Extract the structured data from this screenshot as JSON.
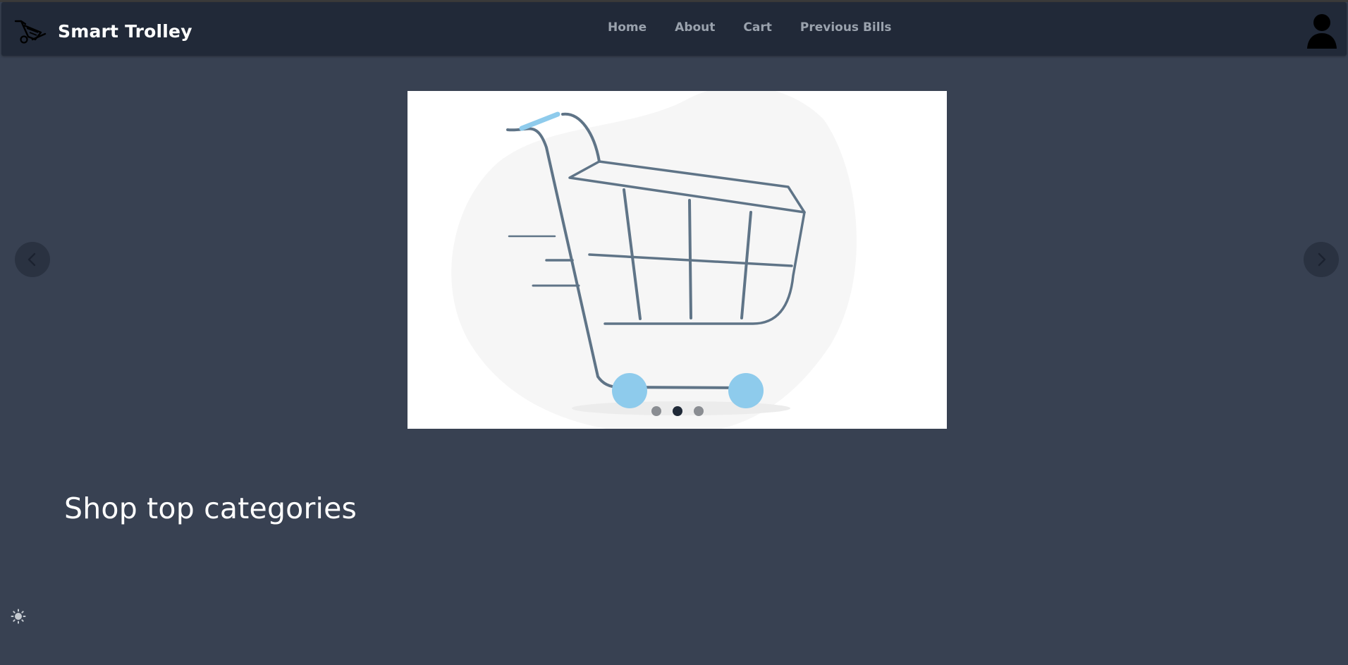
{
  "brand": {
    "name": "Smart Trolley",
    "logo_icon": "trolley-logo-icon"
  },
  "nav": {
    "links": [
      {
        "label": "Home"
      },
      {
        "label": "About"
      },
      {
        "label": "Cart"
      },
      {
        "label": "Previous Bills"
      }
    ],
    "user_icon": "user-avatar-icon"
  },
  "carousel": {
    "image": "shopping-cart-illustration",
    "slide_count": 3,
    "active_slide": 2,
    "prev_icon": "chevron-left-icon",
    "next_icon": "chevron-right-icon"
  },
  "main": {
    "section_title": "Shop top categories"
  },
  "theme_toggle": {
    "icon": "sun-icon"
  },
  "colors": {
    "background": "#384152",
    "navbar": "#212938",
    "nav_link": "#9aa2ad",
    "cart_stroke": "#5f7487",
    "cart_accent": "#8ecbec"
  }
}
